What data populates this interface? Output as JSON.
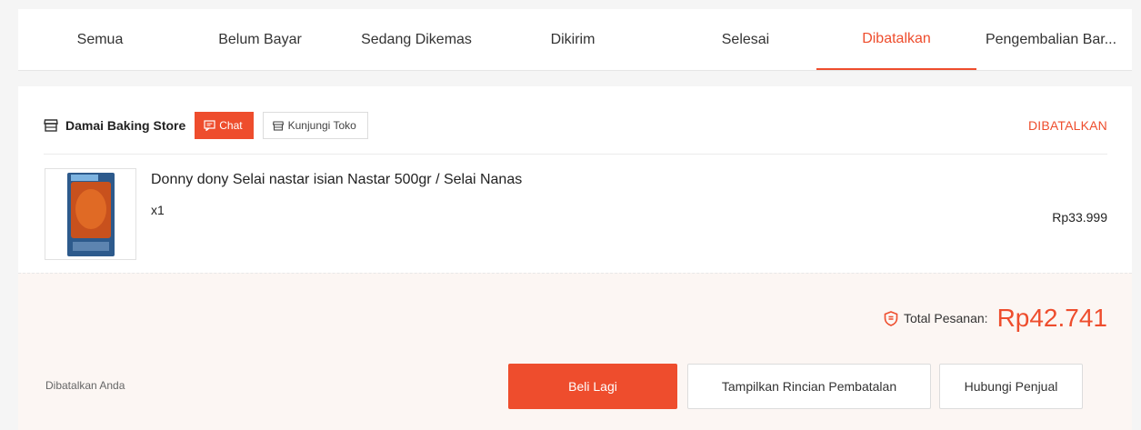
{
  "tabs": [
    {
      "label": "Semua",
      "active": false
    },
    {
      "label": "Belum Bayar",
      "active": false
    },
    {
      "label": "Sedang Dikemas",
      "active": false
    },
    {
      "label": "Dikirim",
      "active": false
    },
    {
      "label": "Selesai",
      "active": false
    },
    {
      "label": "Dibatalkan",
      "active": true
    },
    {
      "label": "Pengembalian Bar...",
      "active": false
    }
  ],
  "shop": {
    "name": "Damai Baking Store",
    "chat_label": "Chat",
    "visit_label": "Kunjungi Toko"
  },
  "order": {
    "status": "DIBATALKAN",
    "product_name": "Donny dony Selai nastar isian Nastar 500gr / Selai Nanas",
    "quantity": "x1",
    "price": "Rp33.999"
  },
  "summary": {
    "total_label": "Total Pesanan:",
    "total_value": "Rp42.741",
    "cancel_note": "Dibatalkan Anda",
    "buy_again_label": "Beli Lagi",
    "cancel_details_label": "Tampilkan Rincian Pembatalan",
    "contact_seller_label": "Hubungi Penjual"
  },
  "colors": {
    "accent": "#ee4d2d"
  }
}
